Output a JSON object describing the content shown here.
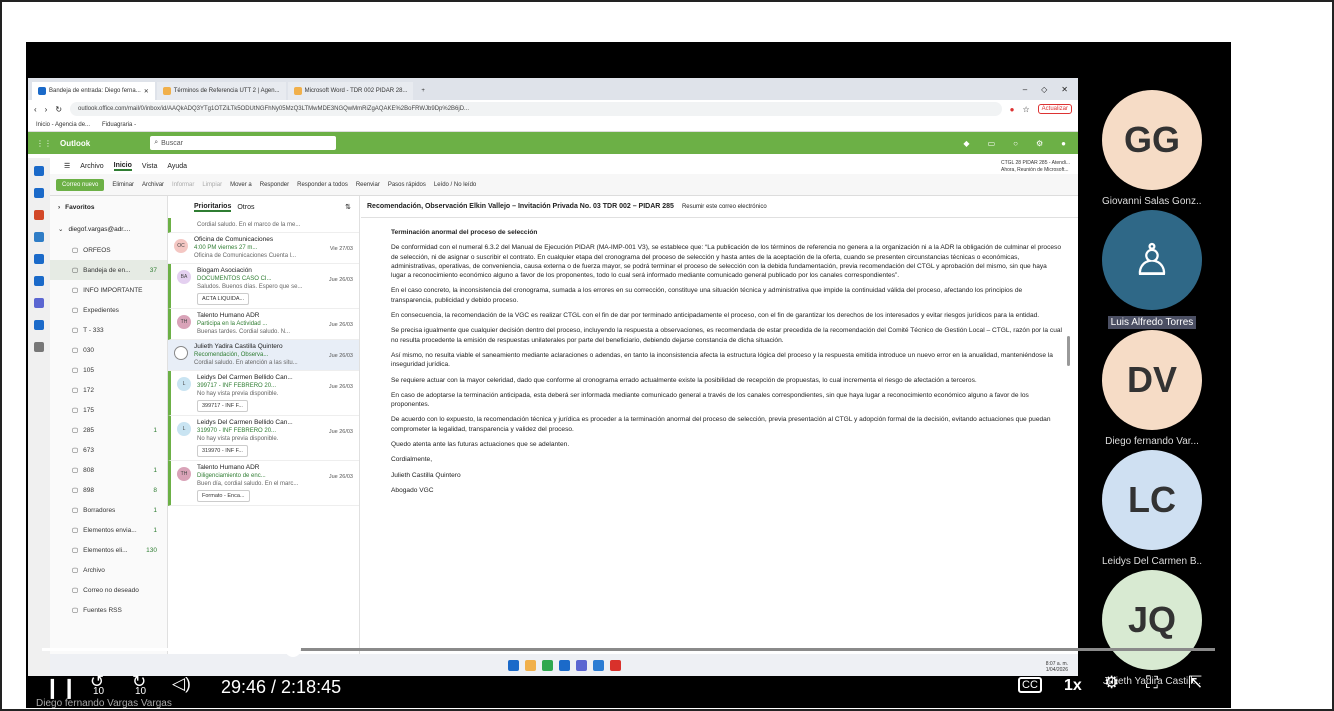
{
  "browser": {
    "tabs": [
      {
        "label": "Bandeja de entrada: Diego ferna...",
        "active": true
      },
      {
        "label": "Términos de Referencia UTT 2 | Agen...",
        "active": false
      },
      {
        "label": "Microsoft Word - TDR 002 PIDAR 28...",
        "active": false
      }
    ],
    "url": "outlook.office.com/mail/0/inbox/id/AAQkADQ3YTg1OTZiLTk5ODUtNGFhNy05MzQ3LTMwMDE3NGQwMmRiZgAQAKE%2BoFRWJb9Dp%2B6jD...",
    "update_label": "Actualizar",
    "bookmarks": [
      "Inicio - Agencia de...",
      "Fiduagraria -"
    ]
  },
  "outlook": {
    "app_name": "Outlook",
    "search_placeholder": "Buscar",
    "menu": [
      "Archivo",
      "Inicio",
      "Vista",
      "Ayuda"
    ],
    "notice": {
      "line1": "CTGL 28 PIDAR 285 - Atendi...",
      "line2": "Ahora, Reunión de Microsoft..."
    },
    "ribbon": {
      "new_mail": "Correo nuevo",
      "delete": "Eliminar",
      "archive": "Archivar",
      "report": "Informar",
      "clean": "Limpiar",
      "move": "Mover a",
      "reply": "Responder",
      "reply_all": "Responder a todos",
      "forward": "Reenviar",
      "quick_steps": "Pasos rápidos",
      "read_unread": "Leído / No leído"
    },
    "folders": {
      "favorites": "Favoritos",
      "account": "diegof.vargas@adr....",
      "items": [
        {
          "label": "ORFEOS",
          "count": ""
        },
        {
          "label": "Bandeja de en...",
          "count": "37",
          "selected": true
        },
        {
          "label": "INFO IMPORTANTE",
          "count": ""
        },
        {
          "label": "Expedientes",
          "count": ""
        },
        {
          "label": "T - 333",
          "count": ""
        },
        {
          "label": "030",
          "count": ""
        },
        {
          "label": "105",
          "count": ""
        },
        {
          "label": "172",
          "count": ""
        },
        {
          "label": "175",
          "count": ""
        },
        {
          "label": "285",
          "count": "1"
        },
        {
          "label": "673",
          "count": ""
        },
        {
          "label": "808",
          "count": "1"
        },
        {
          "label": "898",
          "count": "8"
        },
        {
          "label": "Borradores",
          "count": "1"
        },
        {
          "label": "Elementos envia...",
          "count": "1"
        },
        {
          "label": "Elementos eli...",
          "count": "130"
        },
        {
          "label": "Archivo",
          "count": ""
        },
        {
          "label": "Correo no deseado",
          "count": ""
        },
        {
          "label": "Fuentes RSS",
          "count": ""
        }
      ]
    },
    "list": {
      "tab_focused": "Prioritarios",
      "tab_other": "Otros",
      "top_preview": "Cordial saludo. En el marco de la me...",
      "items": [
        {
          "initials": "OC",
          "sender": "Oficina de Comunicaciones",
          "subject": "4:00 PM viernes 27 m...",
          "date": "Vie 27/03",
          "preview": "Oficina de Comunicaciones Cuenta l...",
          "chip": "",
          "color": "#f4c7c3"
        },
        {
          "initials": "BA",
          "sender": "Biogam Asociación",
          "subject": "DOCUMENTOS CASO CI...",
          "date": "Jue 26/03",
          "preview": "Saludos. Buenos días. Espero que se...",
          "chip": "ACTA LIQUIDA...",
          "color": "#e4d0f0"
        },
        {
          "initials": "TH",
          "sender": "Talento Humano ADR",
          "subject": "Participa en la Actividad ...",
          "date": "Jue 26/03",
          "preview": "Buenas tardes. Cordial saludo. N...",
          "chip": "",
          "color": "#d9a3b8"
        },
        {
          "initials": "",
          "sender": "Julieth Yadira Castilla Quintero",
          "subject": "Recomendación, Observa...",
          "date": "Jue 26/03",
          "preview": "Cordial saludo. En atención a las situ...",
          "chip": "",
          "color": "#ffffff",
          "highlight": true
        },
        {
          "initials": "L",
          "sender": "Leidys Del Carmen Bellido Can...",
          "subject": "399717 - INF FEBRERO 20...",
          "date": "Jue 26/03",
          "preview": "No hay vista previa disponible.",
          "chip": "399717 - INF F...",
          "color": "#c9e4f2"
        },
        {
          "initials": "L",
          "sender": "Leidys Del Carmen Bellido Can...",
          "subject": "319970 - INF FEBRERO 20...",
          "date": "Jue 26/03",
          "preview": "No hay vista previa disponible.",
          "chip": "319970 - INF F...",
          "color": "#c9e4f2"
        },
        {
          "initials": "TH",
          "sender": "Talento Humano ADR",
          "subject": "Diligenciamiento de enc...",
          "date": "Jue 26/03",
          "preview": "Buen día, cordial saludo. En el marc...",
          "chip": "Formato - Enca...",
          "color": "#d9a3b8"
        }
      ]
    },
    "reading": {
      "subject": "Recomendación, Observación Elkin Vallejo – Invitación Privada No. 03 TDR 002 – PIDAR 285",
      "summary": "Resumir este correo electrónico",
      "heading": "Terminación anormal del proceso de selección",
      "paragraphs": [
        "De conformidad con el numeral 6.3.2 del Manual de Ejecución PIDAR (MA-IMP-001 V3), se establece que: “La publicación de los términos de referencia no genera a la organización ni a la ADR la obligación de culminar el proceso de selección, ni de asignar o suscribir el contrato. En cualquier etapa del cronograma del proceso de selección y hasta antes de la aceptación de la oferta, cuando se presenten circunstancias técnicas o económicas, administrativas, operativas, de conveniencia, causa externa o de fuerza mayor, se podrá terminar el proceso de selección con la debida fundamentación, previa recomendación del CTGL y aprobación del mismo, sin que haya lugar a reconocimiento económico alguno a favor de los proponentes, todo lo cual será informado mediante comunicado general publicado por los canales correspondientes”.",
        "En el caso concreto, la inconsistencia del cronograma, sumada a los errores en su corrección, constituye una situación técnica y administrativa que impide la continuidad válida del proceso, afectando los principios de transparencia, publicidad y debido proceso.",
        "En consecuencia, la recomendación de la VGC es realizar CTGL  con el fin de dar por terminado anticipadamente el proceso, con el fin de garantizar los derechos de los interesados y evitar riesgos jurídicos para la entidad.",
        "Se precisa igualmente que cualquier decisión dentro del proceso, incluyendo la respuesta a observaciones, es recomendada de estar precedida de la recomendación del Comité Técnico de Gestión Local – CTGL, razón por la cual no resulta procedente la emisión de respuestas unilaterales por parte del beneficiario, debiendo dejarse constancia de dicha situación.",
        "Así mismo, no resulta viable el saneamiento mediante aclaraciones o adendas, en tanto la inconsistencia afecta la estructura lógica del proceso y la respuesta emitida introduce un nuevo error en la anualidad, manteniéndose la inseguridad jurídica.",
        "Se requiere actuar con la mayor celeridad, dado que conforme al cronograma errado actualmente existe la posibilidad de recepción de propuestas, lo cual incrementa el riesgo de afectación a terceros.",
        "En caso de adoptarse la terminación anticipada, esta deberá ser informada mediante comunicado general a través de los canales correspondientes, sin que haya lugar a reconocimiento económico alguno a favor de los proponentes.",
        "De acuerdo con lo expuesto, la recomendación técnica y jurídica es proceder a la terminación anormal del proceso de selección, previa presentación al CTGL y adopción formal de la decisión, evitando actuaciones que puedan comprometer la legalidad, transparencia y validez del proceso.",
        "Quedo atenta ante las futuras actuaciones que se adelanten.",
        "Cordialmente,",
        "Julieth Castilla Quintero",
        "Abogado VGC"
      ]
    },
    "clock": {
      "time": "8:07 a. m.",
      "date": "1/04/2026"
    }
  },
  "participants": [
    {
      "initials": "GG",
      "name": "Giovanni Salas Gonz...",
      "color": "#f6dcc6",
      "boxed": false
    },
    {
      "initials": "",
      "name": "Luis Alfredo Torres",
      "color": "#2f6887",
      "boxed": true,
      "icon": "person-icon"
    },
    {
      "initials": "DV",
      "name": "Diego fernando Var...",
      "color": "#f6dcc6",
      "boxed": false
    },
    {
      "initials": "LC",
      "name": "Leidys Del Carmen B...",
      "color": "#cfe0f2",
      "boxed": false
    },
    {
      "initials": "JQ",
      "name": "Julieth Yadira Castill...",
      "color": "#d8ead2",
      "boxed": false
    }
  ],
  "player": {
    "current": "29:46",
    "total": "2:18:45",
    "time_label": "29:46 / 2:18:45",
    "progress": 0.214,
    "rewind_label": "10",
    "forward_label": "10",
    "speed": "1x",
    "cc": "CC",
    "owner": "Diego fernando Vargas Vargas"
  }
}
